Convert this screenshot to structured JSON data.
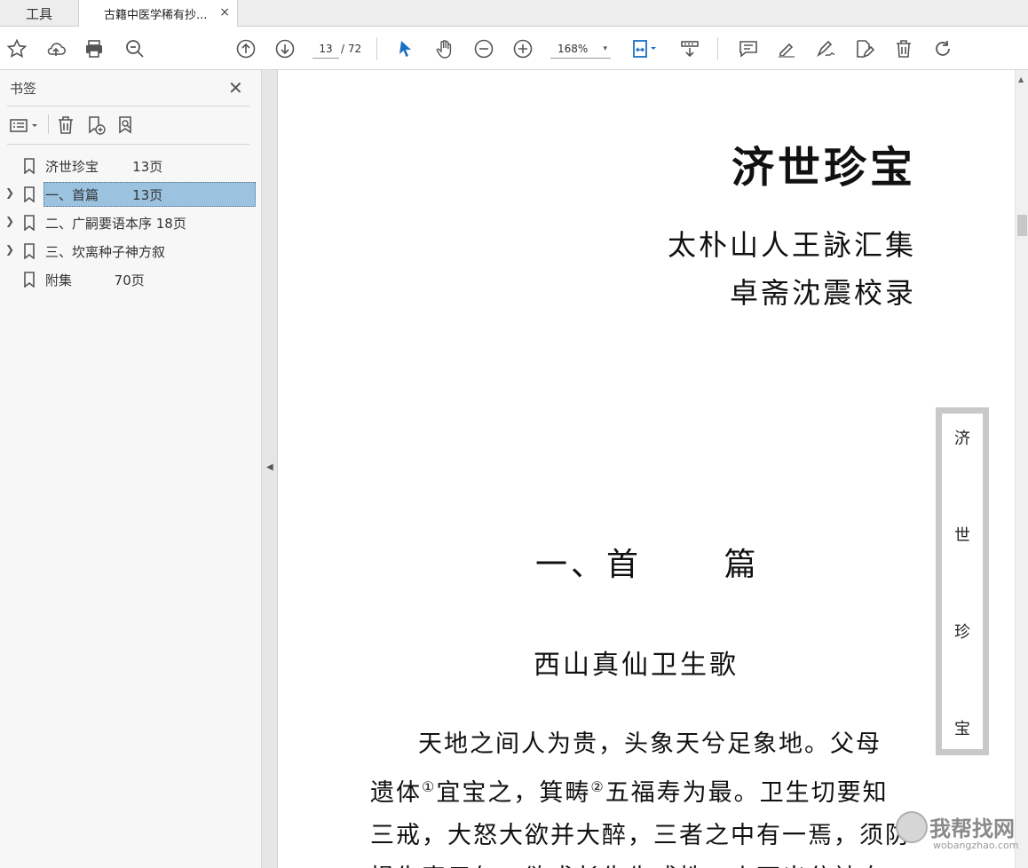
{
  "tabs": {
    "tools_label": "工具",
    "doc_label": "古籍中医学稀有抄...",
    "close_glyph": "×"
  },
  "toolbar": {
    "page_current": "13",
    "page_total": "/ 72",
    "zoom": "168%",
    "zoom_caret": "▾"
  },
  "sidebar": {
    "title": "书签",
    "close_glyph": "✕",
    "bookmarks": [
      {
        "label": "济世珍宝        13页",
        "expandable": false,
        "selected": false
      },
      {
        "label": "一、首篇        13页",
        "expandable": true,
        "selected": true
      },
      {
        "label": "二、广嗣要语本序 18页",
        "expandable": true,
        "selected": false
      },
      {
        "label": "三、坎离种子神方叙",
        "expandable": true,
        "selected": false
      },
      {
        "label": "附集          70页",
        "expandable": false,
        "selected": false
      }
    ],
    "collapse_glyph": "◀"
  },
  "document": {
    "title": "济世珍宝",
    "author_line1": "太朴山人王詠汇集",
    "author_line2": "卓斋沈震校录",
    "side_label": [
      "济",
      "世",
      "珍",
      "宝"
    ],
    "chapter_heading": "一、首      篇",
    "subheading": "西山真仙卫生歌",
    "body_line1": "天地之间人为贵，头象天兮足象地。父母",
    "body_line2a": "遗体",
    "note1": "①",
    "body_line2b": "宜宝之，箕畴",
    "note2": "②",
    "body_line2c": "五福寿为最。卫生切要知",
    "body_line3": "三戒，大怒大欲并大醉，三者之中有一焉，须防",
    "body_line4": "损失真元气。欲求长生先戒性，火不出兮神自"
  },
  "watermark": {
    "cn": "我帮找网",
    "url": "wobangzhao.com"
  },
  "scrollbar": {
    "up_glyph": "▲"
  },
  "colors": {
    "selection": "#9bc3e0",
    "accent_blue": "#1a6fc4"
  }
}
